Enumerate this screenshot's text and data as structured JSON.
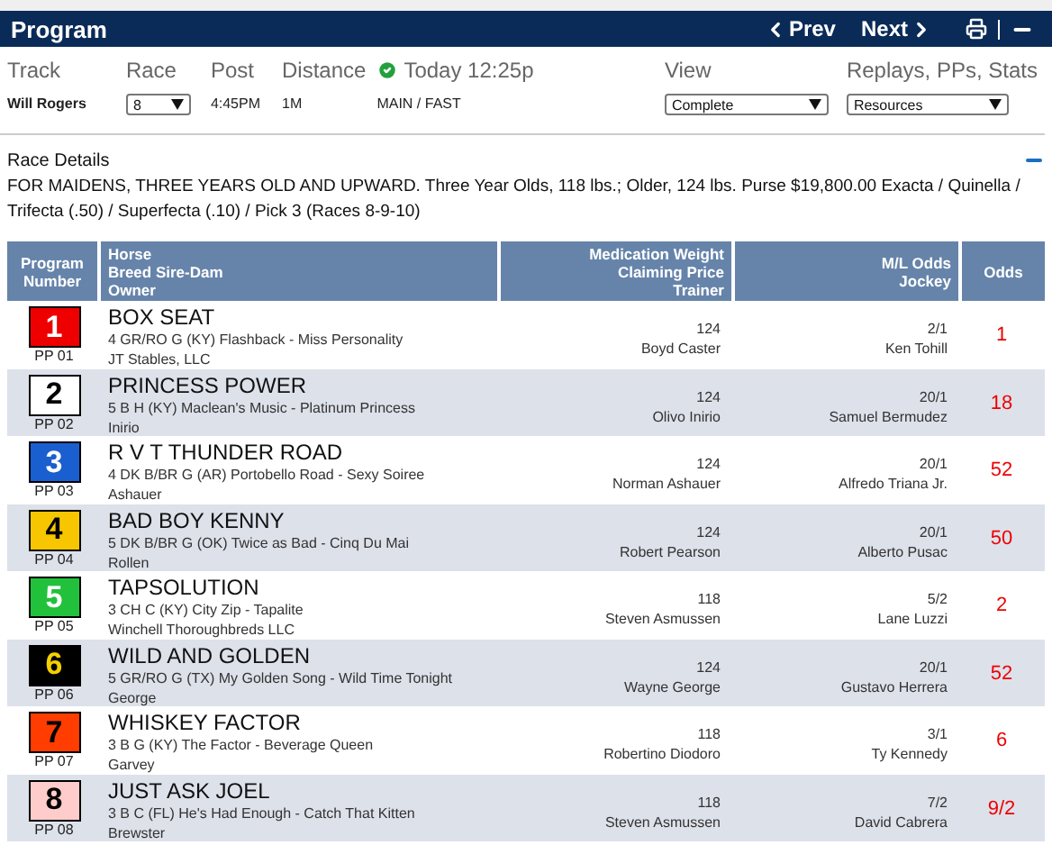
{
  "header": {
    "title": "Program",
    "prev": "Prev",
    "next": "Next"
  },
  "info": {
    "track_label": "Track",
    "track": "Will Rogers",
    "race_label": "Race",
    "race": "8",
    "post_label": "Post",
    "post": "4:45PM",
    "distance_label": "Distance",
    "distance": "1M",
    "status_time": "Today 12:25p",
    "surface": "MAIN / FAST",
    "view_label": "View",
    "view": "Complete",
    "resources_label": "Replays, PPs, Stats",
    "resources": "Resources"
  },
  "race_details": {
    "title": "Race Details",
    "expanded": true,
    "text": "FOR MAIDENS, THREE YEARS OLD AND UPWARD. Three Year Olds, 118 lbs.; Older, 124 lbs. Purse $19,800.00 Exacta / Quinella / Trifecta (.50) / Superfecta (.10) / Pick 3 (Races 8-9-10)"
  },
  "table": {
    "columns": [
      [
        "Program",
        "Number"
      ],
      [
        "Horse",
        "Breed Sire-Dam",
        "Owner"
      ],
      [
        "Medication Weight",
        "Claiming Price",
        "Trainer"
      ],
      [
        "M/L Odds",
        "Jockey"
      ],
      [
        "Odds"
      ]
    ],
    "rows": [
      {
        "number": "1",
        "color": "#ee0000",
        "pp": "PP 01",
        "horse": "BOX SEAT",
        "breed": "4 GR/RO G (KY) Flashback - Miss Personality",
        "owner": "JT Stables, LLC",
        "weight": "124",
        "trainer": "Boyd Caster",
        "ml_odds": "2/1",
        "jockey": "Ken Tohill",
        "odds": "1"
      },
      {
        "number": "2",
        "color": "#ffffff",
        "pp": "PP 02",
        "horse": "PRINCESS POWER",
        "breed": "5 B H (KY) Maclean's Music - Platinum Princess",
        "owner": "Inirio",
        "weight": "124",
        "trainer": "Olivo Inirio",
        "ml_odds": "20/1",
        "jockey": "Samuel Bermudez",
        "odds": "18"
      },
      {
        "number": "3",
        "color": "#1a5fd0",
        "pp": "PP 03",
        "horse": "R V T THUNDER ROAD",
        "breed": "4 DK B/BR G (AR) Portobello Road - Sexy Soiree",
        "owner": "Ashauer",
        "weight": "124",
        "trainer": "Norman Ashauer",
        "ml_odds": "20/1",
        "jockey": "Alfredo Triana Jr.",
        "odds": "52"
      },
      {
        "number": "4",
        "color": "#f7c600",
        "pp": "PP 04",
        "horse": "BAD BOY KENNY",
        "breed": "5 DK B/BR G (OK) Twice as Bad - Cinq Du Mai",
        "owner": "Rollen",
        "weight": "124",
        "trainer": "Robert Pearson",
        "ml_odds": "20/1",
        "jockey": "Alberto Pusac",
        "odds": "50"
      },
      {
        "number": "5",
        "color": "#22c13c",
        "pp": "PP 05",
        "horse": "TAPSOLUTION",
        "breed": "3 CH C (KY) City Zip - Tapalite",
        "owner": "Winchell Thoroughbreds LLC",
        "weight": "118",
        "trainer": "Steven Asmussen",
        "ml_odds": "5/2",
        "jockey": "Lane Luzzi",
        "odds": "2"
      },
      {
        "number": "6",
        "color": "#000000",
        "pp": "PP 06",
        "horse": "WILD AND GOLDEN",
        "breed": "5 GR/RO G (TX) My Golden Song - Wild Time Tonight",
        "owner": "George",
        "weight": "124",
        "trainer": "Wayne George",
        "ml_odds": "20/1",
        "jockey": "Gustavo Herrera",
        "odds": "52"
      },
      {
        "number": "7",
        "color": "#ff3d00",
        "pp": "PP 07",
        "horse": "WHISKEY FACTOR",
        "breed": "3 B G (KY) The Factor - Beverage Queen",
        "owner": "Garvey",
        "weight": "118",
        "trainer": "Robertino Diodoro",
        "ml_odds": "3/1",
        "jockey": "Ty Kennedy",
        "odds": "6"
      },
      {
        "number": "8",
        "color": "#ffcccc",
        "pp": "PP 08",
        "horse": "JUST ASK JOEL",
        "breed": "3 B C (FL) He's Had Enough - Catch That Kitten",
        "owner": "Brewster",
        "weight": "118",
        "trainer": "Steven Asmussen",
        "ml_odds": "7/2",
        "jockey": "David Cabrera",
        "odds": "9/2"
      }
    ]
  }
}
